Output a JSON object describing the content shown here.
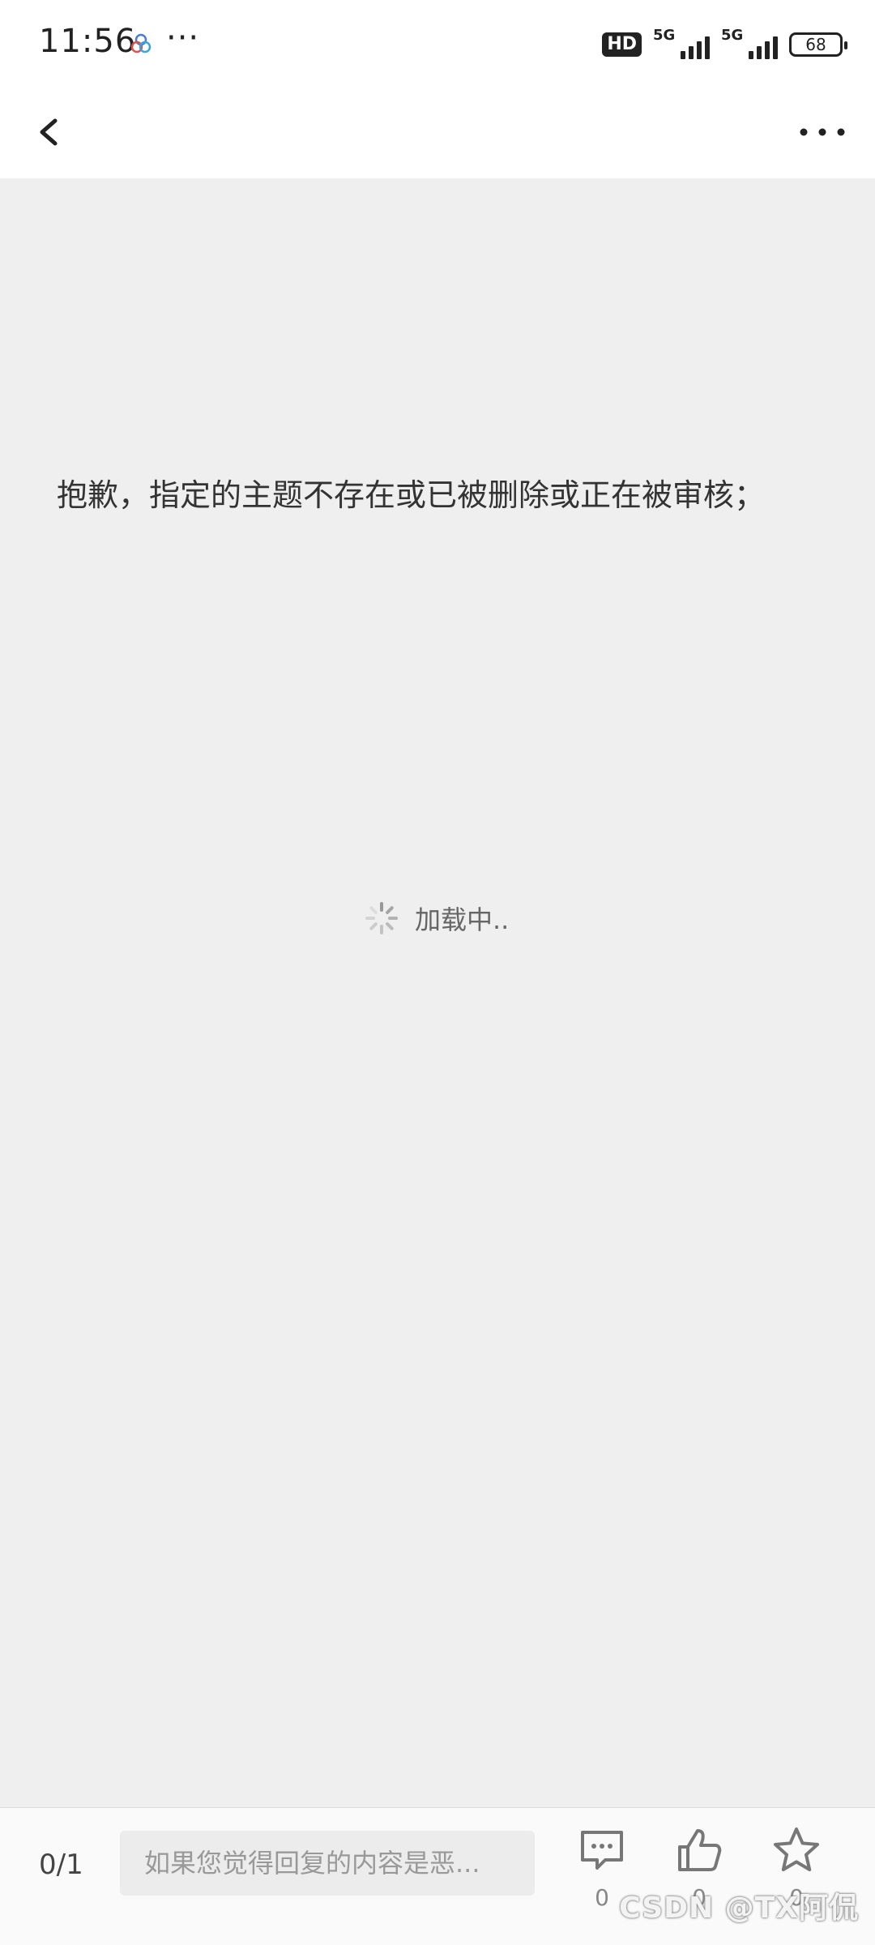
{
  "status_bar": {
    "time": "11:56",
    "more": "···",
    "hd": "HD",
    "sim1_network": "5G",
    "sim2_network": "5G",
    "battery": "68"
  },
  "nav": {
    "back_icon": "chevron-left-icon",
    "menu_icon": "more-horizontal-icon"
  },
  "content": {
    "notice": "抱歉，指定的主题不存在或已被删除或正在被审核；",
    "loading_text": "加载中.."
  },
  "bottom_bar": {
    "page_counter": "0/1",
    "reply_placeholder": "如果您觉得回复的内容是恶...",
    "comment_count": "0",
    "like_count": "0",
    "favorite_count": "0"
  },
  "watermark": "CSDN @TX阿侃",
  "colors": {
    "background": "#efefef",
    "header": "#ffffff",
    "text": "#333333",
    "muted": "#888888"
  }
}
